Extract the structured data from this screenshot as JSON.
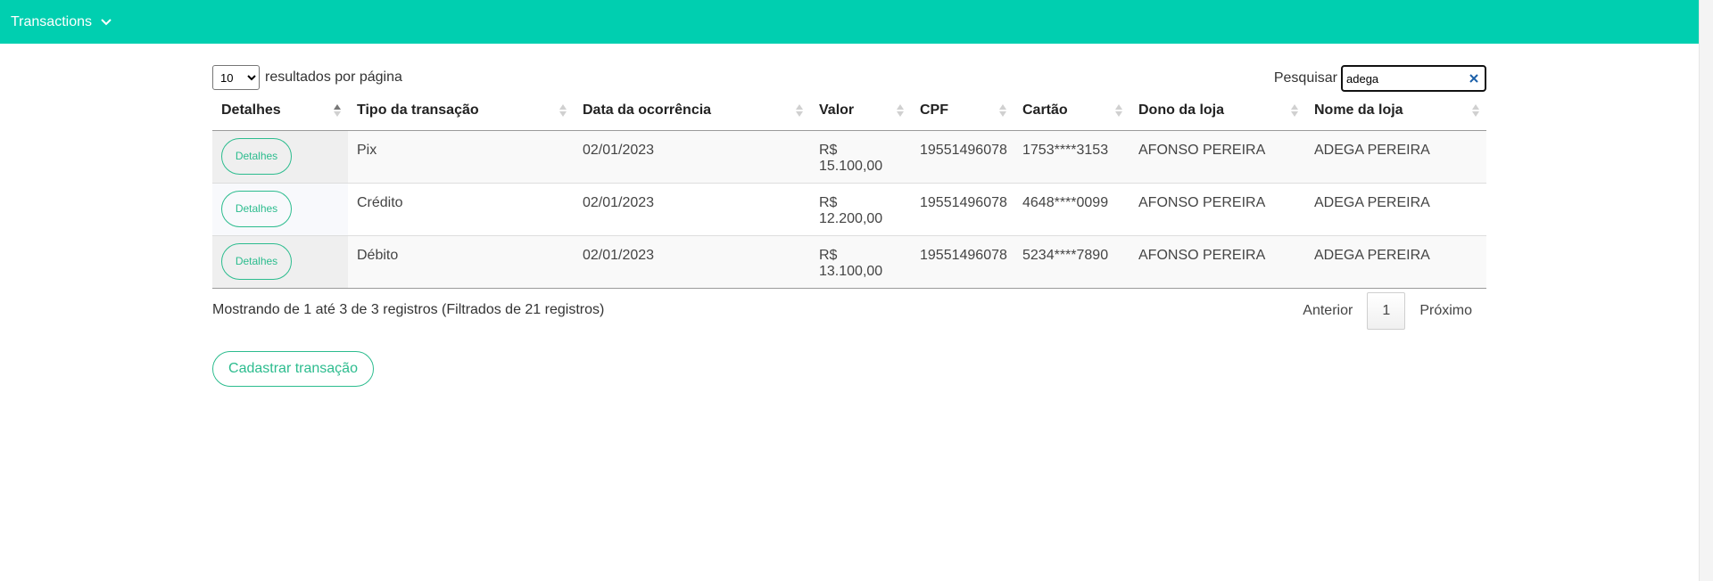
{
  "nav": {
    "title": "Transactions"
  },
  "controls": {
    "page_length_value": "10",
    "page_length_suffix": "resultados por página",
    "search_label": "Pesquisar",
    "search_value": "adega"
  },
  "table": {
    "columns": [
      "Detalhes",
      "Tipo da transação",
      "Data da ocorrência",
      "Valor",
      "CPF",
      "Cartão",
      "Dono da loja",
      "Nome da loja"
    ],
    "detail_label": "Detalhes",
    "rows": [
      {
        "tipo": "Pix",
        "data": "02/01/2023",
        "valor": "R$ 15.100,00",
        "cpf": "19551496078",
        "cartao": "1753****3153",
        "dono": "AFONSO PEREIRA",
        "loja": "ADEGA PEREIRA"
      },
      {
        "tipo": "Crédito",
        "data": "02/01/2023",
        "valor": "R$ 12.200,00",
        "cpf": "19551496078",
        "cartao": "4648****0099",
        "dono": "AFONSO PEREIRA",
        "loja": "ADEGA PEREIRA"
      },
      {
        "tipo": "Débito",
        "data": "02/01/2023",
        "valor": "R$ 13.100,00",
        "cpf": "19551496078",
        "cartao": "5234****7890",
        "dono": "AFONSO PEREIRA",
        "loja": "ADEGA PEREIRA"
      }
    ]
  },
  "footer": {
    "info": "Mostrando de 1 até 3 de 3 registros (Filtrados de 21 registros)",
    "prev": "Anterior",
    "current_page": "1",
    "next": "Próximo"
  },
  "actions": {
    "add_label": "Cadastrar transação"
  },
  "colors": {
    "nav_bg": "#00cfb0",
    "accent": "#2cbc8e"
  },
  "icons": {
    "nav_toggle": "chevron-down-icon",
    "search_clear": "close-icon"
  }
}
